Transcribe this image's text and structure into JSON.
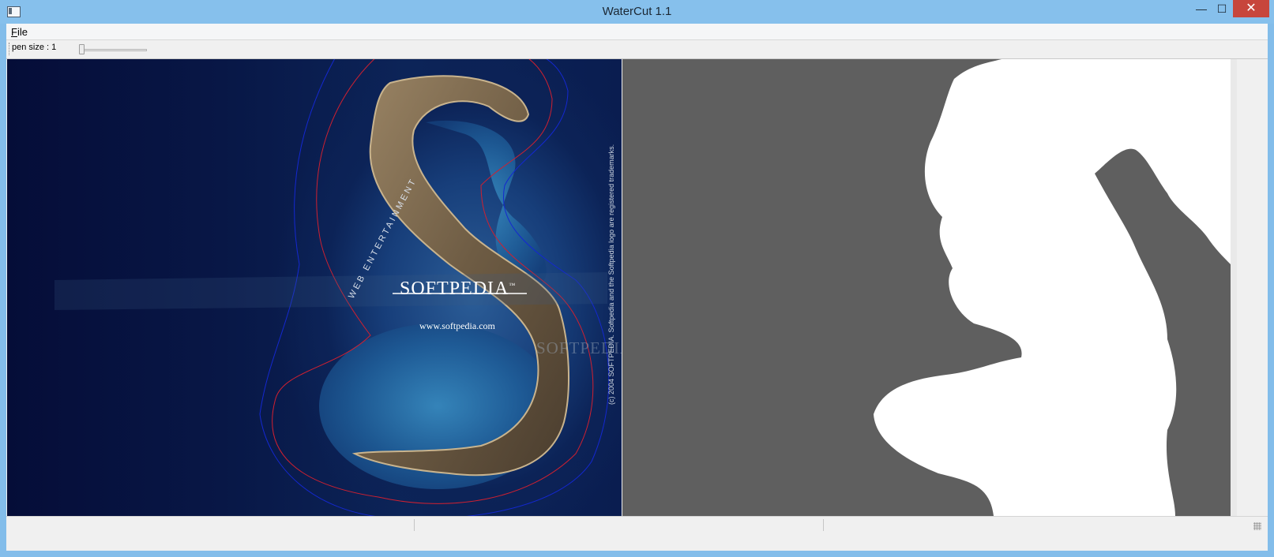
{
  "window": {
    "title": "WaterCut 1.1",
    "minimize_icon": "minimize-icon",
    "maximize_icon": "maximize-icon",
    "close_icon": "close-icon",
    "minimize_glyph": "—",
    "maximize_glyph": "☐",
    "close_glyph": "✕"
  },
  "menu": {
    "items": [
      {
        "label": "File"
      }
    ]
  },
  "toolbar": {
    "pen_size_label": "pen size : 1",
    "pen_size": {
      "value": 1
    }
  },
  "image": {
    "logo_text": "SOFTPEDIA",
    "logo_tm": "™",
    "url_text": "www.softpedia.com",
    "arc_text": "WEB ENTERTAINMENT",
    "watermark_text": "SOFTPEDIA",
    "trademark_text": "(c) 2004 SOFTPEDIA. Softpedia and the Softpedia logo are registered trademarks."
  },
  "colors": {
    "titlebar": "#86c0ec",
    "close_button": "#c7463c",
    "mask_background": "#5f5f5f",
    "mask_foreground": "#ffffff",
    "water_contour_red": "#d02030",
    "water_contour_blue": "#1428d0"
  }
}
